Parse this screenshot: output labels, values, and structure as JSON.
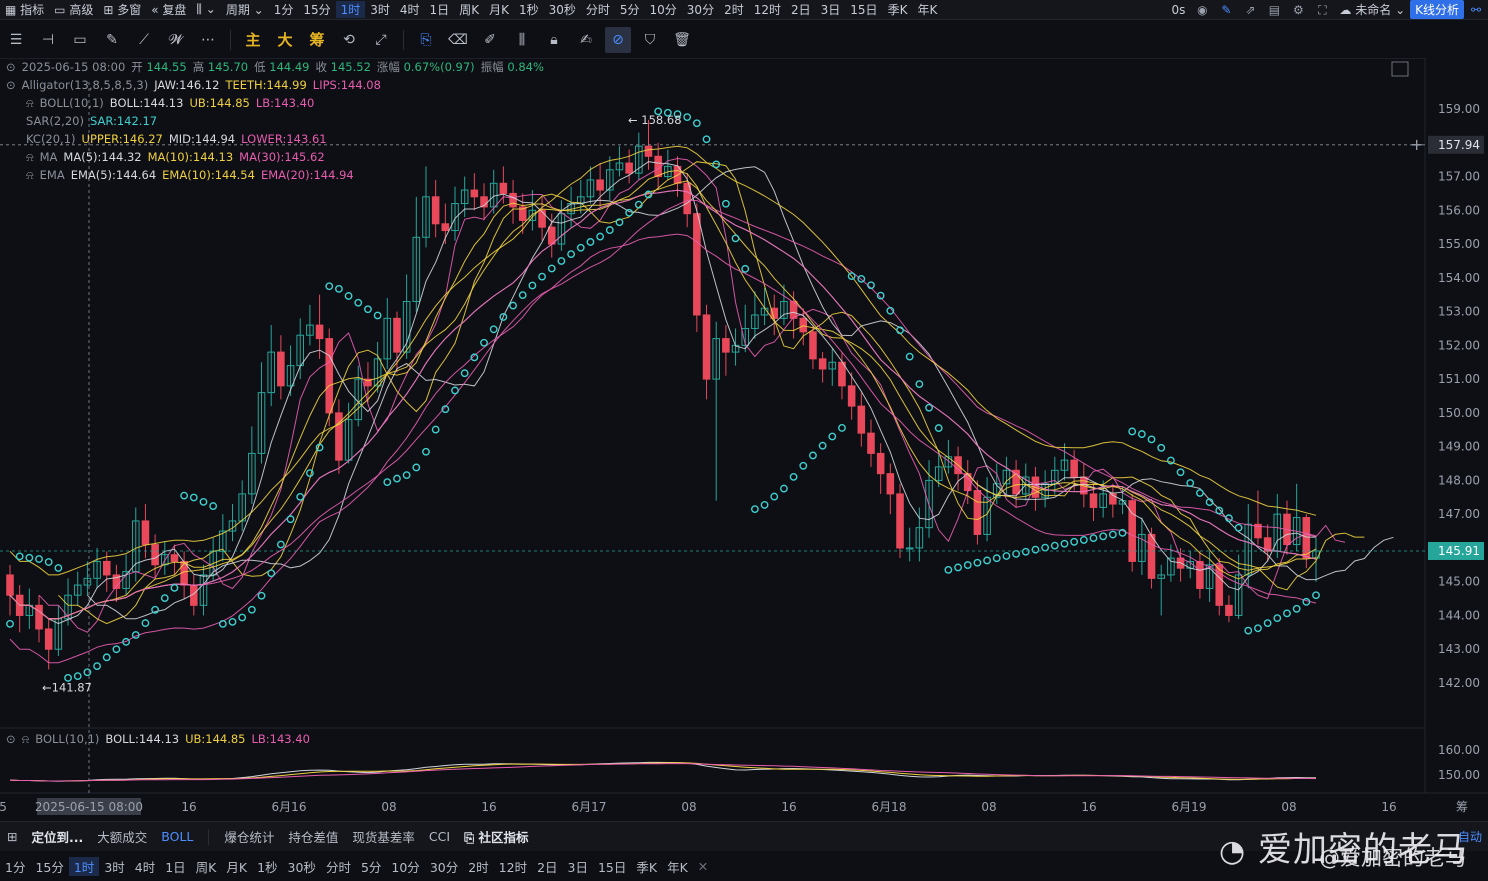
{
  "topbar": {
    "left": [
      {
        "name": "indicator",
        "label": "指标",
        "icon": "bar-icon"
      },
      {
        "name": "advanced",
        "label": "高级",
        "icon": "window-icon"
      },
      {
        "name": "multi",
        "label": "多窗",
        "icon": "grid-icon"
      },
      {
        "name": "restore",
        "label": "复盘",
        "icon": "rewind-icon"
      },
      {
        "name": "candle-type",
        "label": "",
        "icon": "candle-icon"
      },
      {
        "name": "period",
        "label": "周期",
        "icon": ""
      }
    ],
    "periods": [
      "1分",
      "15分",
      "1时",
      "3时",
      "4时",
      "1日",
      "周K",
      "月K",
      "1秒",
      "30秒",
      "分时",
      "5分",
      "10分",
      "30分",
      "2时",
      "12时",
      "2日",
      "3日",
      "15日",
      "季K",
      "年K"
    ],
    "active_period": "1时",
    "right_time": "0s",
    "unnamed": "未命名",
    "kline_btn": "K线分析"
  },
  "toolbar": {
    "yellow_tools": [
      "主",
      "大",
      "筹"
    ]
  },
  "indicators": {
    "ohlc": {
      "date": "2025-06-15 08:00",
      "open_label": "开",
      "open": "144.55",
      "high_label": "高",
      "high": "145.70",
      "low_label": "低",
      "low": "144.49",
      "close_label": "收",
      "close": "145.52",
      "chg_label": "涨幅",
      "chg": "0.67%(0.97)",
      "amp_label": "振幅",
      "amp": "0.84%"
    },
    "alligator": {
      "name": "Alligator(13,8,5,8,5,3)",
      "jaw": "JAW:146.12",
      "teeth": "TEETH:144.99",
      "lips": "LIPS:144.08"
    },
    "boll": {
      "name": "BOLL(10,1)",
      "boll": "BOLL:144.13",
      "ub": "UB:144.85",
      "lb": "LB:143.40"
    },
    "sar": {
      "name": "SAR(2,20)",
      "sar": "SAR:142.17"
    },
    "kc": {
      "name": "KC(20,1)",
      "upper": "UPPER:146.27",
      "mid": "MID:144.94",
      "lower": "LOWER:143.61"
    },
    "ma": {
      "name": "MA",
      "ma5": "MA(5):144.32",
      "ma10": "MA(10):144.13",
      "ma30": "MA(30):145.62"
    },
    "ema": {
      "name": "EMA",
      "ema5": "EMA(5):144.64",
      "ema10": "EMA(10):144.54",
      "ema20": "EMA(20):144.94"
    },
    "sub_boll": {
      "name": "BOLL(10,1)",
      "boll": "BOLL:144.13",
      "ub": "UB:144.85",
      "lb": "LB:143.40"
    }
  },
  "chart_data": {
    "type": "candlestick",
    "y_ticks": [
      "159.00",
      "158.00",
      "157.00",
      "156.00",
      "155.00",
      "154.00",
      "153.00",
      "152.00",
      "151.00",
      "150.00",
      "149.00",
      "148.00",
      "147.00",
      "146.00",
      "145.00",
      "144.00",
      "143.00",
      "142.00"
    ],
    "ylim": [
      141.2,
      159.8
    ],
    "sub_y_ticks": [
      "160.00",
      "150.00"
    ],
    "x_ticks": [
      "5",
      "2025-06-15 08:00",
      "16",
      "6月16",
      "08",
      "16",
      "6月17",
      "08",
      "16",
      "6月18",
      "08",
      "16",
      "6月19",
      "08",
      "16"
    ],
    "x_end_label": "筹",
    "high_marker": "158.68",
    "low_marker": "141.87",
    "crosshair_price": "157.94",
    "last_price": "145.91",
    "candles": [
      [
        145.2,
        144.6,
        145.5,
        144.0
      ],
      [
        144.6,
        144.0,
        144.9,
        143.5
      ],
      [
        144.0,
        144.3,
        144.8,
        143.6
      ],
      [
        144.3,
        143.6,
        144.6,
        143.2
      ],
      [
        143.6,
        143.0,
        143.9,
        142.4
      ],
      [
        143.0,
        143.9,
        144.3,
        142.8
      ],
      [
        143.9,
        144.6,
        145.1,
        143.7
      ],
      [
        144.6,
        144.9,
        145.3,
        144.3
      ],
      [
        144.9,
        145.1,
        145.6,
        144.6
      ],
      [
        145.1,
        145.6,
        146.0,
        144.8
      ],
      [
        145.6,
        145.2,
        145.9,
        144.7
      ],
      [
        145.2,
        144.8,
        145.5,
        144.4
      ],
      [
        144.8,
        145.3,
        145.8,
        144.6
      ],
      [
        145.3,
        146.8,
        147.2,
        145.0
      ],
      [
        146.8,
        146.1,
        147.3,
        145.7
      ],
      [
        146.1,
        145.5,
        146.4,
        145.1
      ],
      [
        145.5,
        145.8,
        146.2,
        145.2
      ],
      [
        145.8,
        145.6,
        146.1,
        145.2
      ],
      [
        145.6,
        144.9,
        145.9,
        144.5
      ],
      [
        144.9,
        144.3,
        145.2,
        144.0
      ],
      [
        144.3,
        145.2,
        145.5,
        144.0
      ],
      [
        145.2,
        145.9,
        146.3,
        145.0
      ],
      [
        145.9,
        146.5,
        147.0,
        145.6
      ],
      [
        146.5,
        146.8,
        147.3,
        146.2
      ],
      [
        146.8,
        147.6,
        148.0,
        146.5
      ],
      [
        147.6,
        148.8,
        149.6,
        147.3
      ],
      [
        148.8,
        150.6,
        151.5,
        148.5
      ],
      [
        150.6,
        151.8,
        152.6,
        150.2
      ],
      [
        151.8,
        150.8,
        152.3,
        150.4
      ],
      [
        150.8,
        151.4,
        152.0,
        150.5
      ],
      [
        151.4,
        152.3,
        152.8,
        151.0
      ],
      [
        152.3,
        152.6,
        153.2,
        152.0
      ],
      [
        152.6,
        152.2,
        153.5,
        151.6
      ],
      [
        152.2,
        150.0,
        152.5,
        149.6
      ],
      [
        150.0,
        148.6,
        150.4,
        148.2
      ],
      [
        148.6,
        149.8,
        150.3,
        148.5
      ],
      [
        149.8,
        151.0,
        151.4,
        149.6
      ],
      [
        151.0,
        150.8,
        151.5,
        150.3
      ],
      [
        150.8,
        151.6,
        152.1,
        150.6
      ],
      [
        151.6,
        152.8,
        153.4,
        151.3
      ],
      [
        152.8,
        151.8,
        153.0,
        151.2
      ],
      [
        151.8,
        153.3,
        154.1,
        151.6
      ],
      [
        153.3,
        155.2,
        156.4,
        153.0
      ],
      [
        155.2,
        156.4,
        157.3,
        154.9
      ],
      [
        156.4,
        155.6,
        156.9,
        155.2
      ],
      [
        155.6,
        155.4,
        156.2,
        155.0
      ],
      [
        155.4,
        156.2,
        156.7,
        155.1
      ],
      [
        156.2,
        156.6,
        157.0,
        155.8
      ],
      [
        156.6,
        156.4,
        157.1,
        156.0
      ],
      [
        156.4,
        156.1,
        156.8,
        155.7
      ],
      [
        156.1,
        156.8,
        157.2,
        155.9
      ],
      [
        156.8,
        156.5,
        157.3,
        156.2
      ],
      [
        156.5,
        156.1,
        156.9,
        155.6
      ],
      [
        156.1,
        155.7,
        156.5,
        155.3
      ],
      [
        155.7,
        156.0,
        156.6,
        155.4
      ],
      [
        156.0,
        155.5,
        156.4,
        155.1
      ],
      [
        155.5,
        155.0,
        155.9,
        154.6
      ],
      [
        155.0,
        155.9,
        156.3,
        154.8
      ],
      [
        155.9,
        156.2,
        156.7,
        155.5
      ],
      [
        156.2,
        156.4,
        156.9,
        155.9
      ],
      [
        156.4,
        156.9,
        157.3,
        156.2
      ],
      [
        156.9,
        156.6,
        157.4,
        156.1
      ],
      [
        156.6,
        157.2,
        157.6,
        156.3
      ],
      [
        157.2,
        157.4,
        157.9,
        157.0
      ],
      [
        157.4,
        157.1,
        157.8,
        156.8
      ],
      [
        157.1,
        157.9,
        158.3,
        156.9
      ],
      [
        157.9,
        157.6,
        158.68,
        157.2
      ],
      [
        157.6,
        157.0,
        158.0,
        156.6
      ],
      [
        157.0,
        157.3,
        157.8,
        156.9
      ],
      [
        157.3,
        156.8,
        157.6,
        156.4
      ],
      [
        156.8,
        155.9,
        157.1,
        155.5
      ],
      [
        155.9,
        152.9,
        156.2,
        152.4
      ],
      [
        152.9,
        151.0,
        153.2,
        150.4
      ],
      [
        151.0,
        152.2,
        152.7,
        147.4
      ],
      [
        152.2,
        151.8,
        152.6,
        151.1
      ],
      [
        151.8,
        152.0,
        152.5,
        151.4
      ],
      [
        152.0,
        152.5,
        153.2,
        151.8
      ],
      [
        152.5,
        152.9,
        153.6,
        152.2
      ],
      [
        152.9,
        153.1,
        153.7,
        152.6
      ],
      [
        153.1,
        152.8,
        153.5,
        152.3
      ],
      [
        152.8,
        153.3,
        153.8,
        152.6
      ],
      [
        153.3,
        152.8,
        153.6,
        152.2
      ],
      [
        152.8,
        152.4,
        153.1,
        152.0
      ],
      [
        152.4,
        151.6,
        152.6,
        151.3
      ],
      [
        151.6,
        151.3,
        151.8,
        150.9
      ],
      [
        151.3,
        151.5,
        151.9,
        150.8
      ],
      [
        151.5,
        150.8,
        151.8,
        150.4
      ],
      [
        150.8,
        150.2,
        151.2,
        149.8
      ],
      [
        150.2,
        149.4,
        150.6,
        149.0
      ],
      [
        149.4,
        148.8,
        149.8,
        148.4
      ],
      [
        148.8,
        148.2,
        149.1,
        147.6
      ],
      [
        148.2,
        147.6,
        148.5,
        147.0
      ],
      [
        147.6,
        146.0,
        147.9,
        145.7
      ],
      [
        146.0,
        146.0,
        146.6,
        145.6
      ],
      [
        146.0,
        146.6,
        147.2,
        145.6
      ],
      [
        146.6,
        148.0,
        148.6,
        146.3
      ],
      [
        148.0,
        148.4,
        148.9,
        147.8
      ],
      [
        148.4,
        148.7,
        149.2,
        148.2
      ],
      [
        148.7,
        148.2,
        149.0,
        147.7
      ],
      [
        148.2,
        147.7,
        148.6,
        147.3
      ],
      [
        147.7,
        146.4,
        148.0,
        146.1
      ],
      [
        146.4,
        147.5,
        148.1,
        146.2
      ],
      [
        147.5,
        147.9,
        148.5,
        147.3
      ],
      [
        147.9,
        148.3,
        148.7,
        147.6
      ],
      [
        148.3,
        147.6,
        148.6,
        147.2
      ],
      [
        147.6,
        148.1,
        148.5,
        147.4
      ],
      [
        148.1,
        147.5,
        148.4,
        147.1
      ],
      [
        147.5,
        147.9,
        148.3,
        147.2
      ],
      [
        147.9,
        148.3,
        148.7,
        147.6
      ],
      [
        148.3,
        148.6,
        149.1,
        148.0
      ],
      [
        148.6,
        148.1,
        148.9,
        147.7
      ],
      [
        148.1,
        147.6,
        148.5,
        147.2
      ],
      [
        147.6,
        147.2,
        147.9,
        146.8
      ],
      [
        147.2,
        147.6,
        148.0,
        146.9
      ],
      [
        147.6,
        147.3,
        147.9,
        146.9
      ],
      [
        147.3,
        147.4,
        147.8,
        147.0
      ],
      [
        147.4,
        145.6,
        147.6,
        145.3
      ],
      [
        145.6,
        146.4,
        146.9,
        145.2
      ],
      [
        146.4,
        145.1,
        146.6,
        144.8
      ],
      [
        145.1,
        145.2,
        145.5,
        144.0
      ],
      [
        145.2,
        145.7,
        146.1,
        145.0
      ],
      [
        145.7,
        145.4,
        146.0,
        145.0
      ],
      [
        145.4,
        145.6,
        145.9,
        145.1
      ],
      [
        145.6,
        144.8,
        145.9,
        144.5
      ],
      [
        144.8,
        145.5,
        145.9,
        144.4
      ],
      [
        145.5,
        144.3,
        145.7,
        144.0
      ],
      [
        144.3,
        144.0,
        144.6,
        143.8
      ],
      [
        144.0,
        145.2,
        145.8,
        143.9
      ],
      [
        145.2,
        146.7,
        147.3,
        144.8
      ],
      [
        146.7,
        146.3,
        147.7,
        146.1
      ],
      [
        146.3,
        145.9,
        146.7,
        145.6
      ],
      [
        145.9,
        147.0,
        147.6,
        145.7
      ],
      [
        147.0,
        146.1,
        147.4,
        145.8
      ],
      [
        146.1,
        146.9,
        147.9,
        145.9
      ],
      [
        146.9,
        145.7,
        147.0,
        145.4
      ],
      [
        145.7,
        145.91,
        146.3,
        145.0
      ]
    ],
    "sar_dots_desc": "parabolic SAR markers",
    "volume_axis": "BOLL sub chart"
  },
  "bottomtabs": {
    "locate": "定位到...",
    "items": [
      "大额成交",
      "BOLL",
      "爆仓统计",
      "持仓差值",
      "现货基差率",
      "CCI"
    ],
    "community": "社区指标"
  },
  "periodbar": {
    "items": [
      "1分",
      "15分",
      "1时",
      "3时",
      "4时",
      "1日",
      "周K",
      "月K",
      "1秒",
      "30秒",
      "分时",
      "5分",
      "10分",
      "30分",
      "2时",
      "12时",
      "2日",
      "3日",
      "15日",
      "季K",
      "年K"
    ],
    "active": "1时"
  },
  "watermark": {
    "big": "爱加密的老马",
    "small": "@爱加密的老马",
    "auto": "自动"
  },
  "colors": {
    "up": "#26a69a",
    "down": "#e8485a",
    "sar": "#3fd0d0",
    "yellow": "#f0d040",
    "pink": "#e85db0",
    "white": "#d0d4dc",
    "bg": "#0d0f14",
    "accent": "#4d8dff"
  }
}
